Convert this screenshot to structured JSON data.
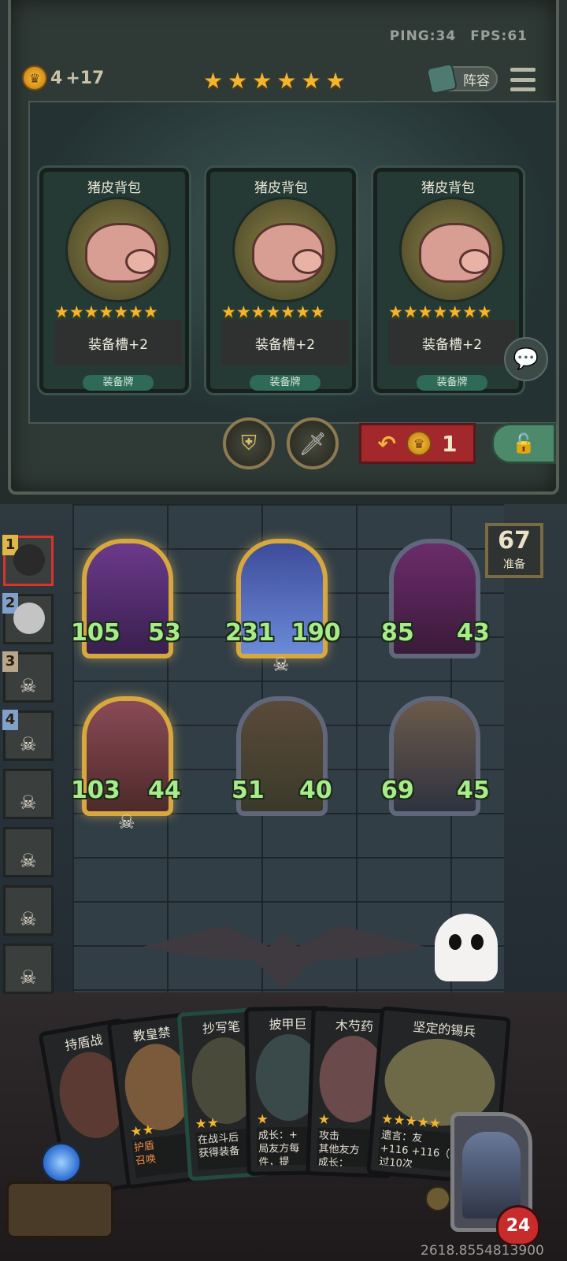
{
  "hud": {
    "ping": "PING:34",
    "fps": "FPS:61",
    "gold": "4",
    "income": "+17",
    "roster_label": "阵容"
  },
  "tavern_stars": 6,
  "shop": {
    "cards": [
      {
        "title": "猪皮背包",
        "stars": "★★★★★★★",
        "effect": "装备槽+2",
        "kind": "装备牌"
      },
      {
        "title": "猪皮背包",
        "stars": "★★★★★★★",
        "effect": "装备槽+2",
        "kind": "装备牌"
      },
      {
        "title": "猪皮背包",
        "stars": "★★★★★★★",
        "effect": "装备槽+2",
        "kind": "装备牌"
      }
    ],
    "refresh_cost": "1"
  },
  "bench": {
    "labels": [
      "1",
      "2",
      "3",
      "4"
    ]
  },
  "ready": {
    "count": "67",
    "label": "准备"
  },
  "board": {
    "units": [
      {
        "atk": "105",
        "hp": "53"
      },
      {
        "atk": "231",
        "hp": "190"
      },
      {
        "atk": "85",
        "hp": "43"
      },
      {
        "atk": "103",
        "hp": "44"
      },
      {
        "atk": "51",
        "hp": "40"
      },
      {
        "atk": "69",
        "hp": "45"
      }
    ]
  },
  "hand": {
    "cards": [
      {
        "name": "持盾战",
        "desc": ""
      },
      {
        "name": "教皇禁",
        "desc": "护盾\n召唤"
      },
      {
        "name": "抄写笔",
        "desc": "在战斗后\n获得装备"
      },
      {
        "name": "披甲巨",
        "desc": "成长：+\n局友方每\n件，提"
      },
      {
        "name": "木芍药",
        "desc": "攻击\n其他友方\n成长："
      },
      {
        "name": "坚定的锡兵",
        "desc": "遗言：友\n+116 +116（本\n过10次"
      }
    ]
  },
  "hero": {
    "hp": "24"
  },
  "coords": "2618.8554813900",
  "colors": {
    "gold": "#f3b52e",
    "stat_green": "#a7ec89",
    "refresh_red": "#a2282b"
  }
}
